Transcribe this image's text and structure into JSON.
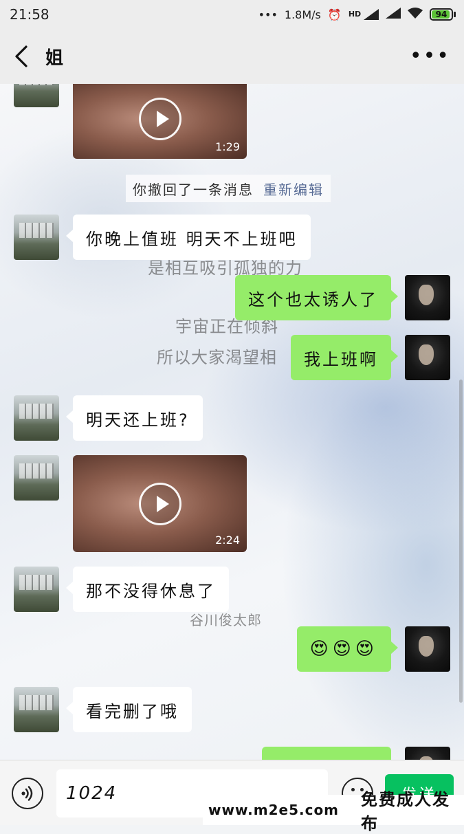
{
  "status_bar": {
    "time": "21:58",
    "network_speed": "1.8M/s",
    "signal_label": "HD",
    "battery": "94",
    "battery_level": 0.94
  },
  "header": {
    "title": "姐",
    "back_icon": "chevron-left-icon",
    "more_icon": "more-dots-icon"
  },
  "chat": {
    "background_text": [
      "是相互吸引孤独的力",
      "宇宙正在倾斜",
      "所以大家渴望相",
      "谷川俊太郎"
    ],
    "messages": [
      {
        "side": "in",
        "type": "video",
        "duration": "1:29"
      },
      {
        "type": "system",
        "text": "你撤回了一条消息",
        "action": "重新编辑"
      },
      {
        "side": "in",
        "type": "text",
        "text": "你晚上值班 明天不上班吧"
      },
      {
        "side": "out",
        "type": "text",
        "text": "这个也太诱人了"
      },
      {
        "side": "out",
        "type": "text",
        "text": "我上班啊"
      },
      {
        "side": "in",
        "type": "text",
        "text": "明天还上班?"
      },
      {
        "side": "in",
        "type": "video",
        "duration": "2:24"
      },
      {
        "side": "in",
        "type": "text",
        "text": "那不没得休息了"
      },
      {
        "side": "out",
        "type": "emoji",
        "text": "😍😍😍"
      },
      {
        "side": "in",
        "type": "text",
        "text": "看完删了哦"
      }
    ]
  },
  "input_bar": {
    "voice_icon": "voice-icon",
    "input_value": "1024",
    "emoji_icon": "emoji-face-icon",
    "send_label": "发送"
  },
  "overlay": {
    "site": "www.m2e5.com",
    "tagline": "免费成人发布"
  },
  "colors": {
    "outgoing_bubble": "#95ec69",
    "incoming_bubble": "#ffffff",
    "send_button": "#07c160",
    "link": "#576b95"
  }
}
